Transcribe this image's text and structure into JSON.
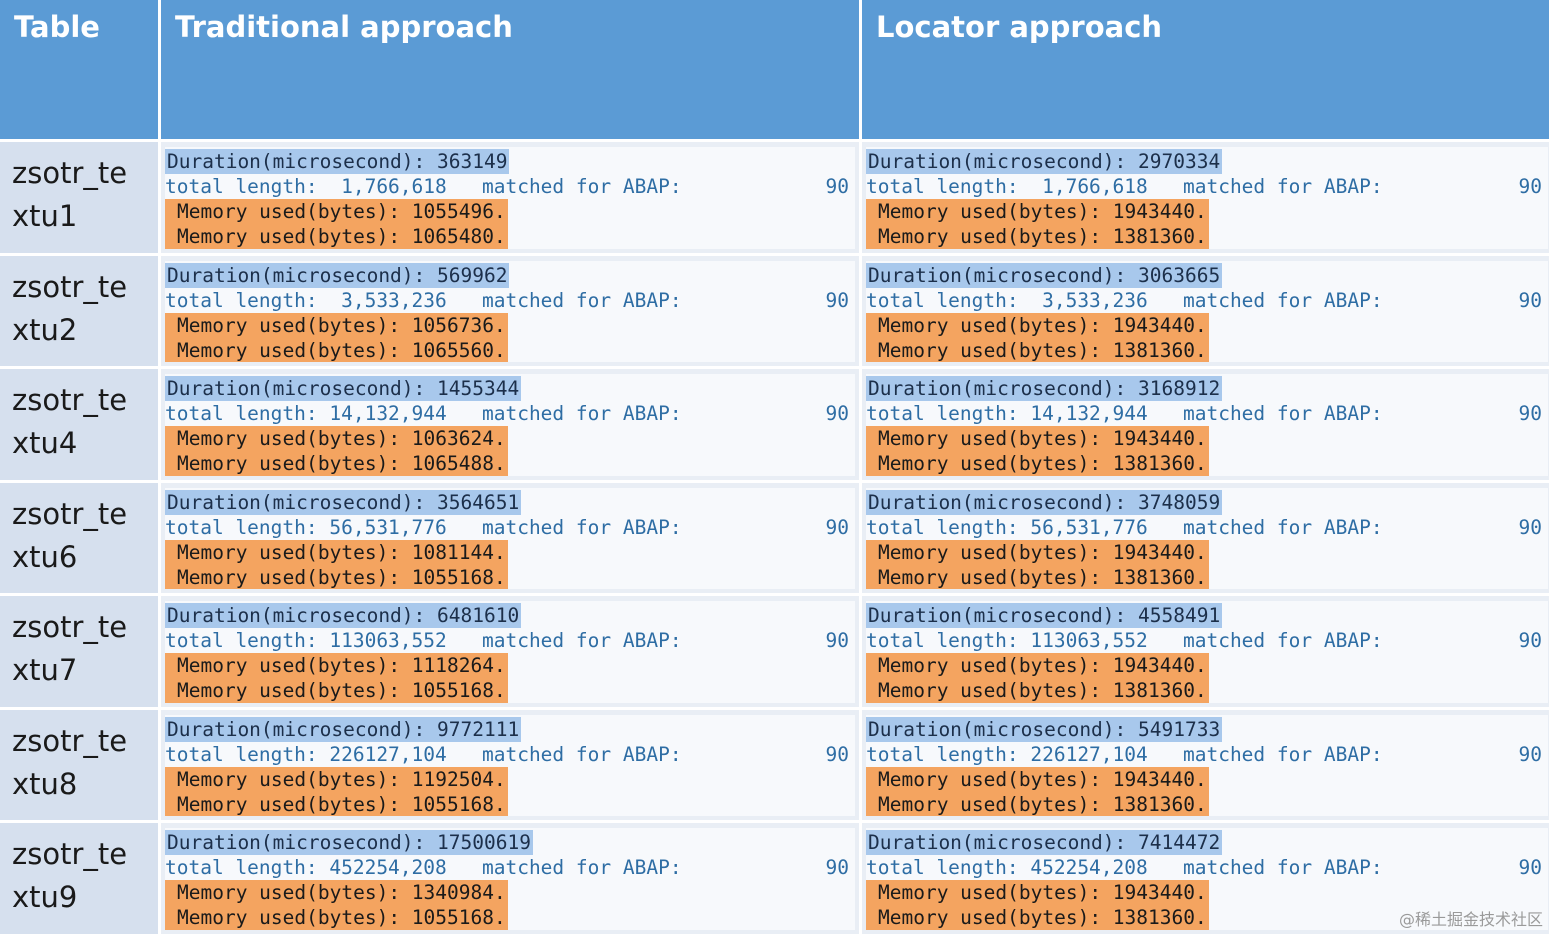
{
  "header": {
    "col1": "Table",
    "col2": "Traditional approach",
    "col3": "Locator approach"
  },
  "rows": [
    {
      "table": "zsotr_te xtu1",
      "traditional": {
        "duration": "Duration(microsecond): 363149",
        "total": "total length:  1,766,618   matched for ABAP:",
        "count": "90",
        "mem1": "Memory used(bytes): 1055496.",
        "mem2": "Memory used(bytes): 1065480."
      },
      "locator": {
        "duration": "Duration(microsecond): 2970334",
        "total": "total length:  1,766,618   matched for ABAP:",
        "count": "90",
        "mem1": "Memory used(bytes): 1943440.",
        "mem2": "Memory used(bytes): 1381360."
      }
    },
    {
      "table": "zsotr_te xtu2",
      "traditional": {
        "duration": "Duration(microsecond): 569962",
        "total": "total length:  3,533,236   matched for ABAP:",
        "count": "90",
        "mem1": "Memory used(bytes): 1056736.",
        "mem2": "Memory used(bytes): 1065560."
      },
      "locator": {
        "duration": "Duration(microsecond): 3063665",
        "total": "total length:  3,533,236   matched for ABAP:",
        "count": "90",
        "mem1": "Memory used(bytes): 1943440.",
        "mem2": "Memory used(bytes): 1381360."
      }
    },
    {
      "table": "zsotr_te xtu4",
      "traditional": {
        "duration": "Duration(microsecond): 1455344",
        "total": "total length: 14,132,944   matched for ABAP:",
        "count": "90",
        "mem1": "Memory used(bytes): 1063624.",
        "mem2": "Memory used(bytes): 1065488."
      },
      "locator": {
        "duration": "Duration(microsecond): 3168912",
        "total": "total length: 14,132,944   matched for ABAP:",
        "count": "90",
        "mem1": "Memory used(bytes): 1943440.",
        "mem2": "Memory used(bytes): 1381360."
      }
    },
    {
      "table": "zsotr_te xtu6",
      "traditional": {
        "duration": "Duration(microsecond): 3564651",
        "total": "total length: 56,531,776   matched for ABAP:",
        "count": "90",
        "mem1": "Memory used(bytes): 1081144.",
        "mem2": "Memory used(bytes): 1055168."
      },
      "locator": {
        "duration": "Duration(microsecond): 3748059",
        "total": "total length: 56,531,776   matched for ABAP:",
        "count": "90",
        "mem1": "Memory used(bytes): 1943440.",
        "mem2": "Memory used(bytes): 1381360."
      }
    },
    {
      "table": "zsotr_te xtu7",
      "traditional": {
        "duration": "Duration(microsecond): 6481610",
        "total": "total length: 113063,552   matched for ABAP:",
        "count": "90",
        "mem1": "Memory used(bytes): 1118264.",
        "mem2": "Memory used(bytes): 1055168."
      },
      "locator": {
        "duration": "Duration(microsecond): 4558491",
        "total": "total length: 113063,552   matched for ABAP:",
        "count": "90",
        "mem1": "Memory used(bytes): 1943440.",
        "mem2": "Memory used(bytes): 1381360."
      }
    },
    {
      "table": "zsotr_te xtu8",
      "traditional": {
        "duration": "Duration(microsecond): 9772111",
        "total": "total length: 226127,104   matched for ABAP:",
        "count": "90",
        "mem1": "Memory used(bytes): 1192504.",
        "mem2": "Memory used(bytes): 1055168."
      },
      "locator": {
        "duration": "Duration(microsecond): 5491733",
        "total": "total length: 226127,104   matched for ABAP:",
        "count": "90",
        "mem1": "Memory used(bytes): 1943440.",
        "mem2": "Memory used(bytes): 1381360."
      }
    },
    {
      "table": "zsotr_te xtu9",
      "traditional": {
        "duration": "Duration(microsecond): 17500619",
        "total": "total length: 452254,208   matched for ABAP:",
        "count": "90",
        "mem1": "Memory used(bytes): 1340984.",
        "mem2": "Memory used(bytes): 1055168."
      },
      "locator": {
        "duration": "Duration(microsecond): 7414472",
        "total": "total length: 452254,208   matched for ABAP:",
        "count": "90",
        "mem1": "Memory used(bytes): 1943440.",
        "mem2": "Memory used(bytes): 1381360."
      }
    }
  ],
  "watermark": "@稀土掘金技术社区"
}
